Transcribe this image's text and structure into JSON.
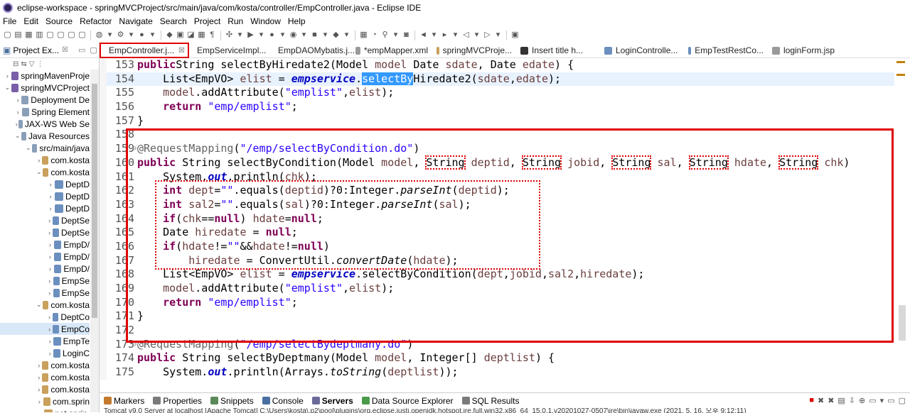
{
  "window": {
    "title": "eclipse-workspace - springMVCProject/src/main/java/com/kosta/controller/EmpController.java - Eclipse IDE"
  },
  "menu": [
    "File",
    "Edit",
    "Source",
    "Refactor",
    "Navigate",
    "Search",
    "Project",
    "Run",
    "Window",
    "Help"
  ],
  "explorer": {
    "title": "Project Ex...",
    "close": "☒",
    "items": [
      {
        "label": "springMavenProje",
        "depth": 0,
        "arrow": "›"
      },
      {
        "label": "springMVCProject",
        "depth": 0,
        "arrow": "⌄"
      },
      {
        "label": "Deployment De",
        "depth": 1,
        "arrow": "›"
      },
      {
        "label": "Spring Element",
        "depth": 1,
        "arrow": "›"
      },
      {
        "label": "JAX-WS Web Se",
        "depth": 1,
        "arrow": "›"
      },
      {
        "label": "Java Resources",
        "depth": 1,
        "arrow": "⌄"
      },
      {
        "label": "src/main/java",
        "depth": 2,
        "arrow": "⌄"
      },
      {
        "label": "com.kosta",
        "depth": 3,
        "arrow": "›"
      },
      {
        "label": "com.kosta",
        "depth": 3,
        "arrow": "⌄"
      },
      {
        "label": "DeptD",
        "depth": 4,
        "arrow": "›"
      },
      {
        "label": "DeptD",
        "depth": 4,
        "arrow": "›"
      },
      {
        "label": "DeptD",
        "depth": 4,
        "arrow": "›"
      },
      {
        "label": "DeptSe",
        "depth": 4,
        "arrow": "›"
      },
      {
        "label": "DeptSe",
        "depth": 4,
        "arrow": "›"
      },
      {
        "label": "EmpD/",
        "depth": 4,
        "arrow": "›"
      },
      {
        "label": "EmpD/",
        "depth": 4,
        "arrow": "›"
      },
      {
        "label": "EmpD/",
        "depth": 4,
        "arrow": "›"
      },
      {
        "label": "EmpSe",
        "depth": 4,
        "arrow": "›"
      },
      {
        "label": "EmpSe",
        "depth": 4,
        "arrow": "›"
      },
      {
        "label": "com.kosta",
        "depth": 3,
        "arrow": "⌄"
      },
      {
        "label": "DeptCo",
        "depth": 4,
        "arrow": "›"
      },
      {
        "label": "EmpCo",
        "depth": 4,
        "arrow": "›"
      },
      {
        "label": "EmpTe",
        "depth": 4,
        "arrow": "›"
      },
      {
        "label": "LoginC",
        "depth": 4,
        "arrow": "›"
      },
      {
        "label": "com.kosta",
        "depth": 3,
        "arrow": "›"
      },
      {
        "label": "com.kosta",
        "depth": 3,
        "arrow": "›"
      },
      {
        "label": "com.kosta",
        "depth": 3,
        "arrow": "›"
      },
      {
        "label": "com.sprin",
        "depth": 3,
        "arrow": "›"
      },
      {
        "label": "net.sprin",
        "depth": 3,
        "arrow": "›"
      }
    ]
  },
  "tabs": [
    {
      "label": "EmpController.j...",
      "close": "☒",
      "icon_color": "#6b8fbf"
    },
    {
      "label": "EmpServiceImpl...",
      "close": "",
      "icon_color": "#6b8fbf"
    },
    {
      "label": "EmpDAOMybatis.j...",
      "close": "",
      "icon_color": "#6b8fbf"
    },
    {
      "label": "*empMapper.xml",
      "close": "",
      "icon_color": "#9a9a9a"
    },
    {
      "label": "springMVCProje...",
      "close": "",
      "icon_color": "#c9a15c"
    },
    {
      "label": "Insert title h...",
      "close": "",
      "icon_color": "#333333"
    },
    {
      "label": "LoginControlle...",
      "close": "",
      "icon_color": "#6b8fbf"
    },
    {
      "label": "EmpTestRestCo...",
      "close": "",
      "icon_color": "#6b8fbf"
    },
    {
      "label": "loginForm.jsp",
      "close": "",
      "icon_color": "#9a9a9a"
    }
  ],
  "code": [
    {
      "n": "153",
      "fold": "",
      "segs": [
        [
          "kw",
          "public"
        ],
        [
          "",
          "String selectByHiredate2(Model "
        ],
        [
          "var",
          "model"
        ],
        [
          "",
          " Date "
        ],
        [
          "var",
          "sdate"
        ],
        [
          "",
          ", Date "
        ],
        [
          "var",
          "edate"
        ],
        [
          "",
          ") {"
        ]
      ]
    },
    {
      "n": "154",
      "fold": "",
      "hl": true,
      "segs": [
        [
          "",
          "    List<EmpVO> "
        ],
        [
          "var",
          "elist"
        ],
        [
          "",
          " = "
        ],
        [
          "fld",
          "empservice"
        ],
        [
          "",
          "."
        ],
        [
          "selword",
          "selectBy"
        ],
        [
          "",
          "Hiredate2("
        ],
        [
          "var",
          "sdate"
        ],
        [
          "",
          ","
        ],
        [
          "var",
          "edate"
        ],
        [
          "",
          ");"
        ]
      ]
    },
    {
      "n": "155",
      "fold": "",
      "segs": [
        [
          "",
          "    "
        ],
        [
          "var",
          "model"
        ],
        [
          "",
          ".addAttribute("
        ],
        [
          "str",
          "\"emplist\""
        ],
        [
          "",
          ","
        ],
        [
          "var",
          "elist"
        ],
        [
          "",
          ");"
        ]
      ]
    },
    {
      "n": "156",
      "fold": "",
      "segs": [
        [
          "",
          "    "
        ],
        [
          "kw",
          "return"
        ],
        [
          "",
          " "
        ],
        [
          "str",
          "\"emp/emplist\""
        ],
        [
          "",
          ";"
        ]
      ]
    },
    {
      "n": "157",
      "fold": "",
      "segs": [
        [
          "",
          "}"
        ]
      ]
    },
    {
      "n": "158",
      "fold": "",
      "segs": [
        [
          "",
          ""
        ]
      ]
    },
    {
      "n": "159",
      "fold": "⊖",
      "segs": [
        [
          "ann",
          "@RequestMapping"
        ],
        [
          "",
          "("
        ],
        [
          "str",
          "\"/emp/selectByCondition.do\""
        ],
        [
          "",
          ")"
        ]
      ]
    },
    {
      "n": "160",
      "fold": "",
      "segs": [
        [
          "kw",
          "public"
        ],
        [
          "",
          " String selectByCondition(Model "
        ],
        [
          "var",
          "model"
        ],
        [
          "",
          ", "
        ],
        [
          "dot",
          "String"
        ],
        [
          "",
          " "
        ],
        [
          "var",
          "deptid"
        ],
        [
          "",
          ", "
        ],
        [
          "dot",
          "String"
        ],
        [
          "",
          " "
        ],
        [
          "var",
          "jobid"
        ],
        [
          "",
          ", "
        ],
        [
          "dot",
          "String"
        ],
        [
          "",
          " "
        ],
        [
          "var",
          "sal"
        ],
        [
          "",
          ", "
        ],
        [
          "dot",
          "String"
        ],
        [
          "",
          " "
        ],
        [
          "var",
          "hdate"
        ],
        [
          "",
          ", "
        ],
        [
          "dot",
          "String"
        ],
        [
          "",
          " "
        ],
        [
          "var",
          "chk"
        ],
        [
          "",
          ")"
        ]
      ]
    },
    {
      "n": "161",
      "fold": "",
      "segs": [
        [
          "",
          "    System."
        ],
        [
          "fld",
          "out"
        ],
        [
          "",
          ".println("
        ],
        [
          "var",
          "chk"
        ],
        [
          "",
          ");"
        ]
      ]
    },
    {
      "n": "162",
      "fold": "",
      "segs": [
        [
          "",
          "    "
        ],
        [
          "kw",
          "int"
        ],
        [
          "",
          " "
        ],
        [
          "var",
          "dept"
        ],
        [
          "",
          "="
        ],
        [
          "str",
          "\"\""
        ],
        [
          "",
          ".equals("
        ],
        [
          "var",
          "deptid"
        ],
        [
          "",
          ")?0:Integer."
        ],
        [
          "it",
          "parseInt"
        ],
        [
          "",
          "("
        ],
        [
          "var",
          "deptid"
        ],
        [
          "",
          ");"
        ]
      ]
    },
    {
      "n": "163",
      "fold": "",
      "segs": [
        [
          "",
          "    "
        ],
        [
          "kw",
          "int"
        ],
        [
          "",
          " "
        ],
        [
          "var",
          "sal2"
        ],
        [
          "",
          "="
        ],
        [
          "str",
          "\"\""
        ],
        [
          "",
          ".equals("
        ],
        [
          "var",
          "sal"
        ],
        [
          "",
          ")?0:Integer."
        ],
        [
          "it",
          "parseInt"
        ],
        [
          "",
          "("
        ],
        [
          "var",
          "sal"
        ],
        [
          "",
          ");"
        ]
      ]
    },
    {
      "n": "164",
      "fold": "",
      "segs": [
        [
          "",
          "    "
        ],
        [
          "kw",
          "if"
        ],
        [
          "",
          "("
        ],
        [
          "var",
          "chk"
        ],
        [
          "",
          "=="
        ],
        [
          "kw",
          "null"
        ],
        [
          "",
          ") "
        ],
        [
          "var",
          "hdate"
        ],
        [
          "",
          "="
        ],
        [
          "kw",
          "null"
        ],
        [
          "",
          ";"
        ]
      ]
    },
    {
      "n": "165",
      "fold": "",
      "segs": [
        [
          "",
          "    Date "
        ],
        [
          "var",
          "hiredate"
        ],
        [
          "",
          " = "
        ],
        [
          "kw",
          "null"
        ],
        [
          "",
          ";"
        ]
      ]
    },
    {
      "n": "166",
      "fold": "",
      "segs": [
        [
          "",
          "    "
        ],
        [
          "kw",
          "if"
        ],
        [
          "",
          "("
        ],
        [
          "var",
          "hdate"
        ],
        [
          "",
          "!="
        ],
        [
          "str",
          "\"\""
        ],
        [
          "",
          "&&"
        ],
        [
          "var",
          "hdate"
        ],
        [
          "",
          "!="
        ],
        [
          "kw",
          "null"
        ],
        [
          "",
          ")"
        ]
      ]
    },
    {
      "n": "167",
      "fold": "",
      "segs": [
        [
          "",
          "        "
        ],
        [
          "var",
          "hiredate"
        ],
        [
          "",
          " = ConvertUtil."
        ],
        [
          "it",
          "convertDate"
        ],
        [
          "",
          "("
        ],
        [
          "var",
          "hdate"
        ],
        [
          "",
          ");"
        ]
      ]
    },
    {
      "n": "168",
      "fold": "",
      "segs": [
        [
          "",
          "    List<EmpVO> "
        ],
        [
          "var",
          "elist"
        ],
        [
          "",
          " = "
        ],
        [
          "fld",
          "empservice"
        ],
        [
          "",
          ".selectByCondition("
        ],
        [
          "var",
          "dept"
        ],
        [
          "",
          ","
        ],
        [
          "var",
          "jobid"
        ],
        [
          "",
          ","
        ],
        [
          "var",
          "sal2"
        ],
        [
          "",
          ","
        ],
        [
          "var",
          "hiredate"
        ],
        [
          "",
          ");"
        ]
      ]
    },
    {
      "n": "169",
      "fold": "",
      "segs": [
        [
          "",
          "    "
        ],
        [
          "var",
          "model"
        ],
        [
          "",
          ".addAttribute("
        ],
        [
          "str",
          "\"emplist\""
        ],
        [
          "",
          ","
        ],
        [
          "var",
          "elist"
        ],
        [
          "",
          ");"
        ]
      ]
    },
    {
      "n": "170",
      "fold": "",
      "segs": [
        [
          "",
          "    "
        ],
        [
          "kw",
          "return"
        ],
        [
          "",
          " "
        ],
        [
          "str",
          "\"emp/emplist\""
        ],
        [
          "",
          ";"
        ]
      ]
    },
    {
      "n": "171",
      "fold": "",
      "segs": [
        [
          "",
          "}"
        ]
      ]
    },
    {
      "n": "172",
      "fold": "",
      "segs": [
        [
          "",
          ""
        ]
      ]
    },
    {
      "n": "173",
      "fold": "⊖",
      "segs": [
        [
          "ann",
          "@RequestMapping"
        ],
        [
          "",
          "("
        ],
        [
          "str",
          "\"/emp/selectBydeptmany.do\""
        ],
        [
          "",
          ")"
        ]
      ]
    },
    {
      "n": "174",
      "fold": "",
      "segs": [
        [
          "kw",
          "public"
        ],
        [
          "",
          " String selectByDeptmany(Model "
        ],
        [
          "var",
          "model"
        ],
        [
          "",
          ", Integer[] "
        ],
        [
          "var",
          "deptlist"
        ],
        [
          "",
          ") {"
        ]
      ]
    },
    {
      "n": "175",
      "fold": "",
      "segs": [
        [
          "",
          "    System."
        ],
        [
          "fld",
          "out"
        ],
        [
          "",
          ".println(Arrays."
        ],
        [
          "it",
          "toString"
        ],
        [
          "",
          "("
        ],
        [
          "var",
          "deptlist"
        ],
        [
          "",
          "));"
        ]
      ]
    }
  ],
  "bottom": {
    "tabs": [
      {
        "label": "Markers",
        "color": "#c47a2c"
      },
      {
        "label": "Properties",
        "color": "#7a7a7a"
      },
      {
        "label": "Snippets",
        "color": "#5a8a5a"
      },
      {
        "label": "Console",
        "color": "#4a6fa0"
      },
      {
        "label": "Servers",
        "color": "#6a6a9a",
        "active": true
      },
      {
        "label": "Data Source Explorer",
        "color": "#4a9a4a"
      },
      {
        "label": "SQL Results",
        "color": "#7a7a7a"
      }
    ],
    "status": "Tomcat v9.0 Server at localhost [Apache Tomcat] C:\\Users\\kosta\\.p2\\pool\\plugins\\org.eclipse.justj.openjdk.hotspot.jre.full.win32.x86_64_15.0.1.v20201027-0507\\jre\\bin\\javaw.exe  (2021. 5. 16. 오후 9:12:11)"
  }
}
